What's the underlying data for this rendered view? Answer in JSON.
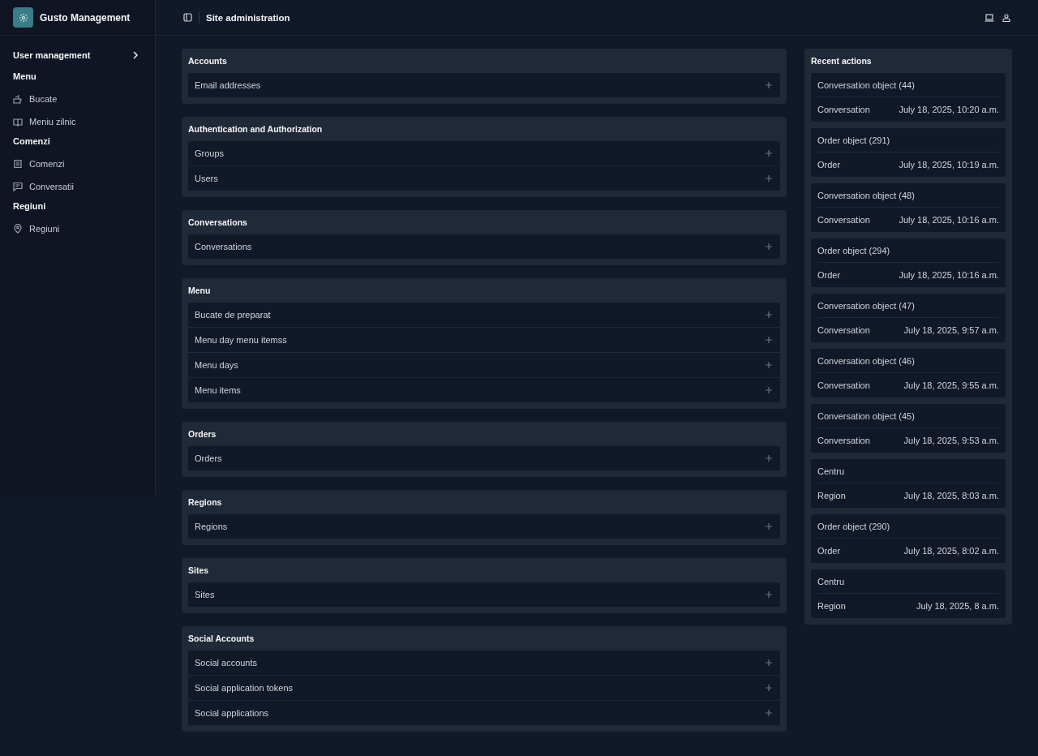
{
  "brand": {
    "name": "Gusto Management"
  },
  "header": {
    "title": "Site administration"
  },
  "sidebar": {
    "items": [
      {
        "kind": "group",
        "label": "User management"
      },
      {
        "kind": "heading",
        "label": "Menu"
      },
      {
        "kind": "link",
        "label": "Bucate"
      },
      {
        "kind": "link",
        "label": "Meniu zilnic"
      },
      {
        "kind": "heading",
        "label": "Comenzi"
      },
      {
        "kind": "link",
        "label": "Comenzi"
      },
      {
        "kind": "link",
        "label": "Conversatii"
      },
      {
        "kind": "heading",
        "label": "Regiuni"
      },
      {
        "kind": "link",
        "label": "Regiuni"
      }
    ]
  },
  "modules": [
    {
      "title": "Accounts",
      "models": [
        "Email addresses"
      ]
    },
    {
      "title": "Authentication and Authorization",
      "models": [
        "Groups",
        "Users"
      ]
    },
    {
      "title": "Conversations",
      "models": [
        "Conversations"
      ]
    },
    {
      "title": "Menu",
      "models": [
        "Bucate de preparat",
        "Menu day menu itemss",
        "Menu days",
        "Menu items"
      ]
    },
    {
      "title": "Orders",
      "models": [
        "Orders"
      ]
    },
    {
      "title": "Regions",
      "models": [
        "Regions"
      ]
    },
    {
      "title": "Sites",
      "models": [
        "Sites"
      ]
    },
    {
      "title": "Social Accounts",
      "models": [
        "Social accounts",
        "Social application tokens",
        "Social applications"
      ]
    }
  ],
  "recent_actions": {
    "title": "Recent actions",
    "items": [
      {
        "object": "Conversation object (44)",
        "type": "Conversation",
        "time": "July 18, 2025, 10:20 a.m."
      },
      {
        "object": "Order object (291)",
        "type": "Order",
        "time": "July 18, 2025, 10:19 a.m."
      },
      {
        "object": "Conversation object (48)",
        "type": "Conversation",
        "time": "July 18, 2025, 10:16 a.m."
      },
      {
        "object": "Order object (294)",
        "type": "Order",
        "time": "July 18, 2025, 10:16 a.m."
      },
      {
        "object": "Conversation object (47)",
        "type": "Conversation",
        "time": "July 18, 2025, 9:57 a.m."
      },
      {
        "object": "Conversation object (46)",
        "type": "Conversation",
        "time": "July 18, 2025, 9:55 a.m."
      },
      {
        "object": "Conversation object (45)",
        "type": "Conversation",
        "time": "July 18, 2025, 9:53 a.m."
      },
      {
        "object": "Centru",
        "type": "Region",
        "time": "July 18, 2025, 8:03 a.m."
      },
      {
        "object": "Order object (290)",
        "type": "Order",
        "time": "July 18, 2025, 8:02 a.m."
      },
      {
        "object": "Centru",
        "type": "Region",
        "time": "July 18, 2025, 8 a.m."
      }
    ]
  }
}
